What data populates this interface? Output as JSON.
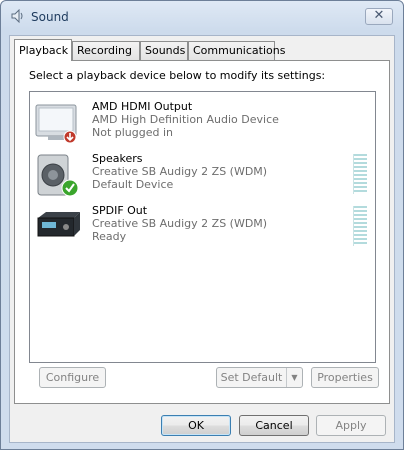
{
  "window": {
    "title": "Sound",
    "close_glyph": "✕"
  },
  "tabs": [
    {
      "label": "Playback",
      "selected": true
    },
    {
      "label": "Recording",
      "selected": false
    },
    {
      "label": "Sounds",
      "selected": false
    },
    {
      "label": "Communications",
      "selected": false
    }
  ],
  "playback": {
    "instruction": "Select a playback device below to modify its settings:",
    "devices": [
      {
        "name": "AMD HDMI Output",
        "description": "AMD High Definition Audio Device",
        "status": "Not plugged in",
        "icon": "monitor-icon",
        "has_meter": false
      },
      {
        "name": "Speakers",
        "description": "Creative SB Audigy 2 ZS (WDM)",
        "status": "Default Device",
        "icon": "speaker-icon",
        "has_meter": true
      },
      {
        "name": "SPDIF Out",
        "description": "Creative SB Audigy 2 ZS (WDM)",
        "status": "Ready",
        "icon": "receiver-icon",
        "has_meter": true
      }
    ],
    "configure_label": "Configure",
    "set_default_label": "Set Default",
    "set_default_arrow": "▼",
    "properties_label": "Properties"
  },
  "footer": {
    "ok_label": "OK",
    "cancel_label": "Cancel",
    "apply_label": "Apply"
  },
  "colors": {
    "default_check": "#3aa52c",
    "unplugged_badge": "#c0392b",
    "meter": "#b3dbdd"
  }
}
